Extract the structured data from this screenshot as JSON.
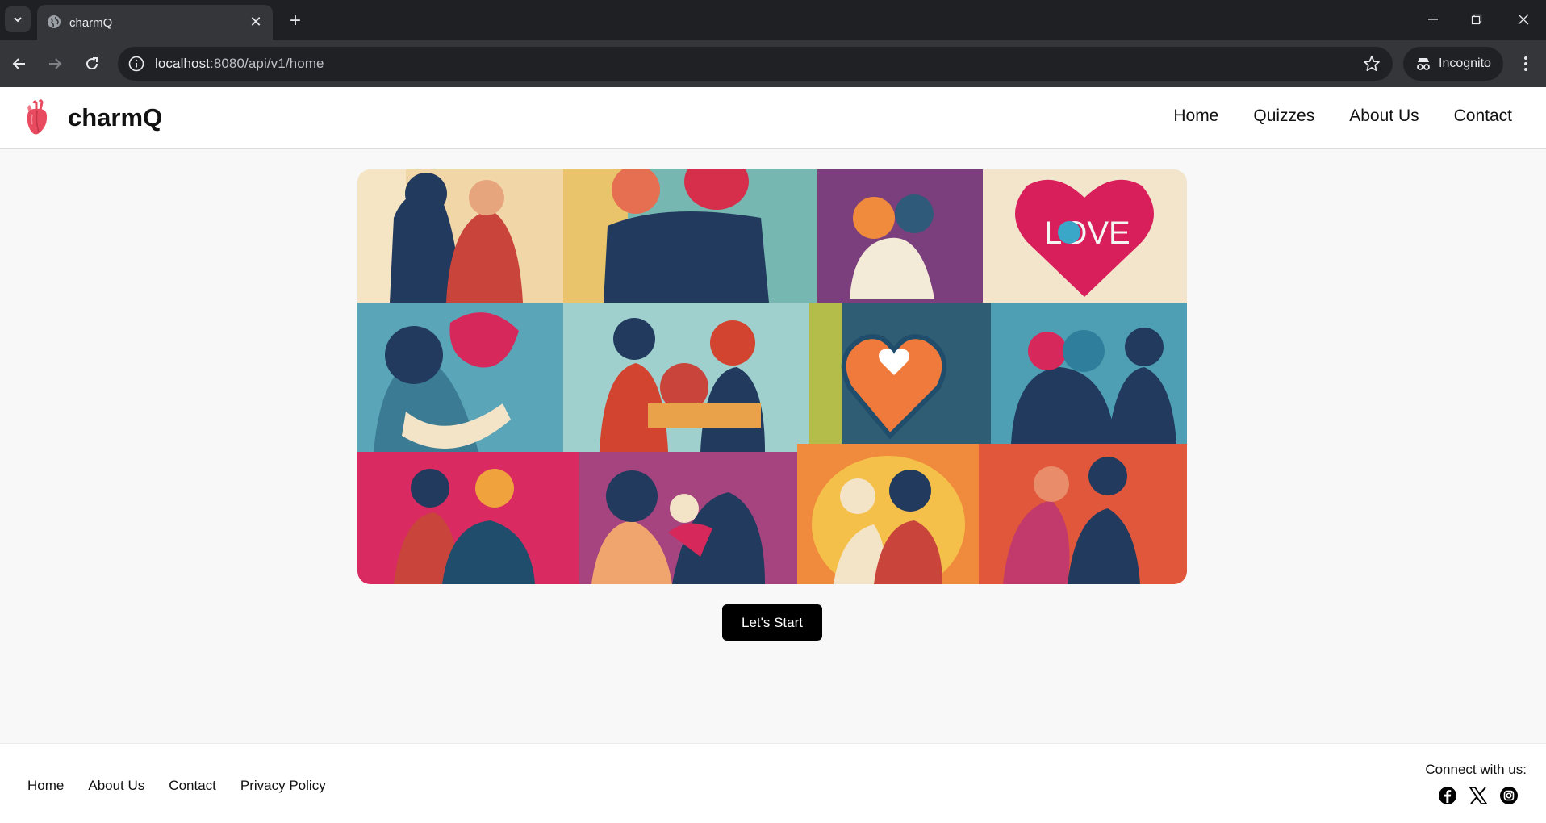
{
  "browser": {
    "tab_title": "charmQ",
    "url_host": "localhost",
    "url_path": ":8080/api/v1/home",
    "profile_label": "Incognito"
  },
  "site": {
    "brand": "charmQ",
    "nav": [
      "Home",
      "Quizzes",
      "About Us",
      "Contact"
    ],
    "cta_label": "Let's Start",
    "hero_text": "LOVE",
    "footer_links": [
      "Home",
      "About Us",
      "Contact",
      "Privacy Policy"
    ],
    "connect_label": "Connect with us:",
    "social_icons": [
      "facebook-icon",
      "x-icon",
      "instagram-icon"
    ]
  },
  "colors": {
    "chrome_dark": "#1f2023",
    "chrome_toolbar": "#35363a",
    "button_bg": "#000000",
    "logo_red": "#e84a5f"
  }
}
